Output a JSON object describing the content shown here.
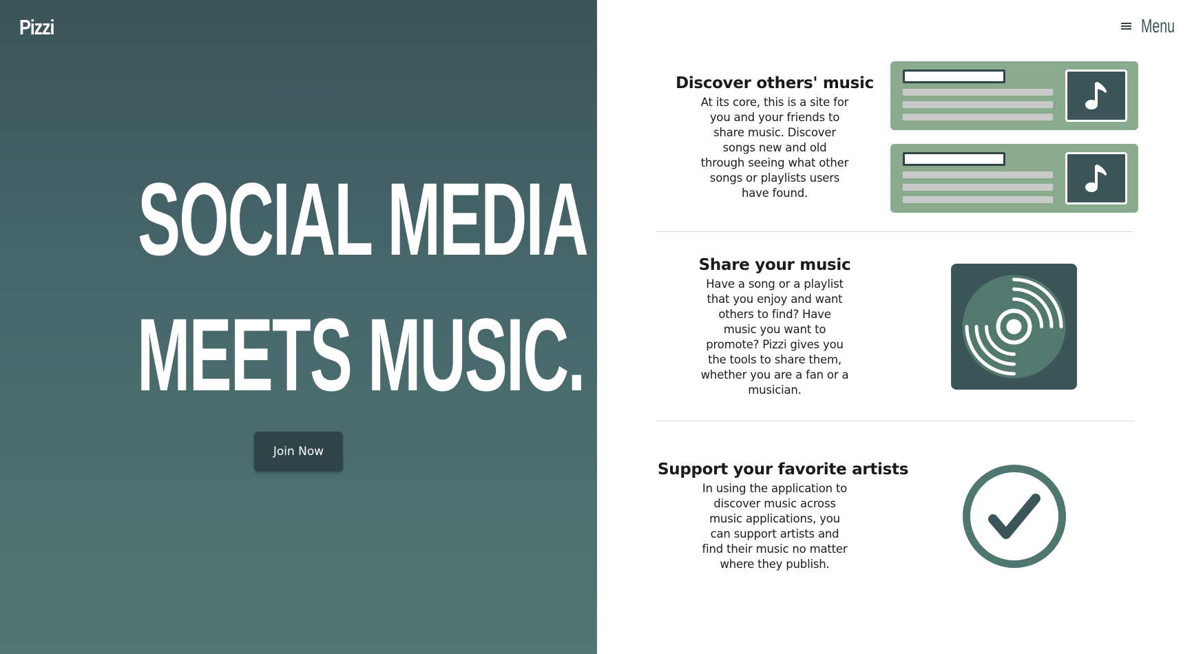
{
  "brand": {
    "logo": "Pizzi"
  },
  "nav": {
    "menu_label": "Menu",
    "menu_icon": "hamburger-icon"
  },
  "hero": {
    "headline_line1": "SOCIAL MEDIA",
    "headline_line2": "MEETS MUSIC.",
    "cta_label": "Join Now"
  },
  "features": [
    {
      "title": "Discover others' music",
      "body": "At its core, this is a site for you and your friends to share music. Discover songs new and old through seeing what other songs or playlists users have found.",
      "icon": "song-list-cards-icon"
    },
    {
      "title": "Share your music",
      "body": "Have a song or a playlist that you enjoy and want others to find? Have music you want to promote? Pizzi gives you the tools to share them, whether you are a fan or a musician.",
      "icon": "vinyl-disc-icon"
    },
    {
      "title": "Support your favorite artists",
      "body": "In using the application to discover music across music applications, you can support artists and find their music no matter where they publish.",
      "icon": "checkmark-circle-icon"
    }
  ],
  "colors": {
    "hero_gradient_top": "#3b5457",
    "hero_gradient_bottom": "#507770",
    "button_bg": "#2f4447",
    "card_green": "#8aab8e",
    "dark_teal": "#3c5559",
    "accent_teal": "#4f7770"
  }
}
